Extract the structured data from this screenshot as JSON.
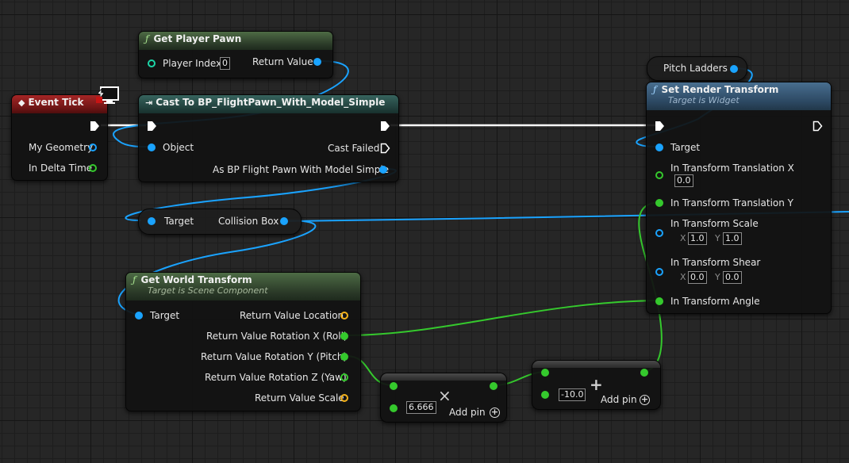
{
  "nodes": {
    "get_player_pawn": {
      "title": "Get Player Pawn",
      "player_index_label": "Player Index",
      "player_index_value": "0",
      "return_value_label": "Return Value"
    },
    "event_tick": {
      "title": "Event Tick",
      "my_geometry_label": "My Geometry",
      "in_delta_time_label": "In Delta Time"
    },
    "cast": {
      "title": "Cast To BP_FlightPawn_With_Model_Simple",
      "object_label": "Object",
      "cast_failed_label": "Cast Failed",
      "as_label": "As BP Flight Pawn With Model Simple"
    },
    "pitch_ladders": {
      "label": "Pitch Ladders"
    },
    "set_render_transform": {
      "title": "Set Render Transform",
      "subtitle": "Target is Widget",
      "target_label": "Target",
      "translation_x_label": "In Transform Translation X",
      "translation_x_value": "0.0",
      "translation_y_label": "In Transform Translation Y",
      "scale_label": "In Transform Scale",
      "scale_x": "1.0",
      "scale_y": "1.0",
      "shear_label": "In Transform Shear",
      "shear_x": "0.0",
      "shear_y": "0.0",
      "angle_label": "In Transform Angle",
      "x_letter": "X",
      "y_letter": "Y"
    },
    "collision_box": {
      "target_label": "Target",
      "collision_label": "Collision Box"
    },
    "get_world_transform": {
      "title": "Get World Transform",
      "subtitle": "Target is Scene Component",
      "target_label": "Target",
      "location_label": "Return Value Location",
      "roll_label": "Return Value Rotation X (Roll)",
      "pitch_label": "Return Value Rotation Y (Pitch)",
      "yaw_label": "Return Value Rotation Z (Yaw)",
      "scale_label": "Return Value Scale"
    },
    "multiply": {
      "value": "6.666",
      "add_pin_label": "Add pin",
      "symbol": "×"
    },
    "add": {
      "value": "-10.0",
      "add_pin_label": "Add pin",
      "symbol": "+"
    }
  },
  "icons": {
    "function": "ƒ",
    "event": "◆",
    "cast": "⇥",
    "add": "+",
    "monitor": "monitor-icon"
  },
  "colors": {
    "exec": "#ffffff",
    "object_wire": "#1aa3ff",
    "float_wire": "#35c92d",
    "vector_pin": "#f4b21b",
    "rotator_pin": "#1cd6a8",
    "event_header": "#a52626",
    "function_header": "#3e5a3a",
    "widget_header": "#3c5f7e"
  }
}
